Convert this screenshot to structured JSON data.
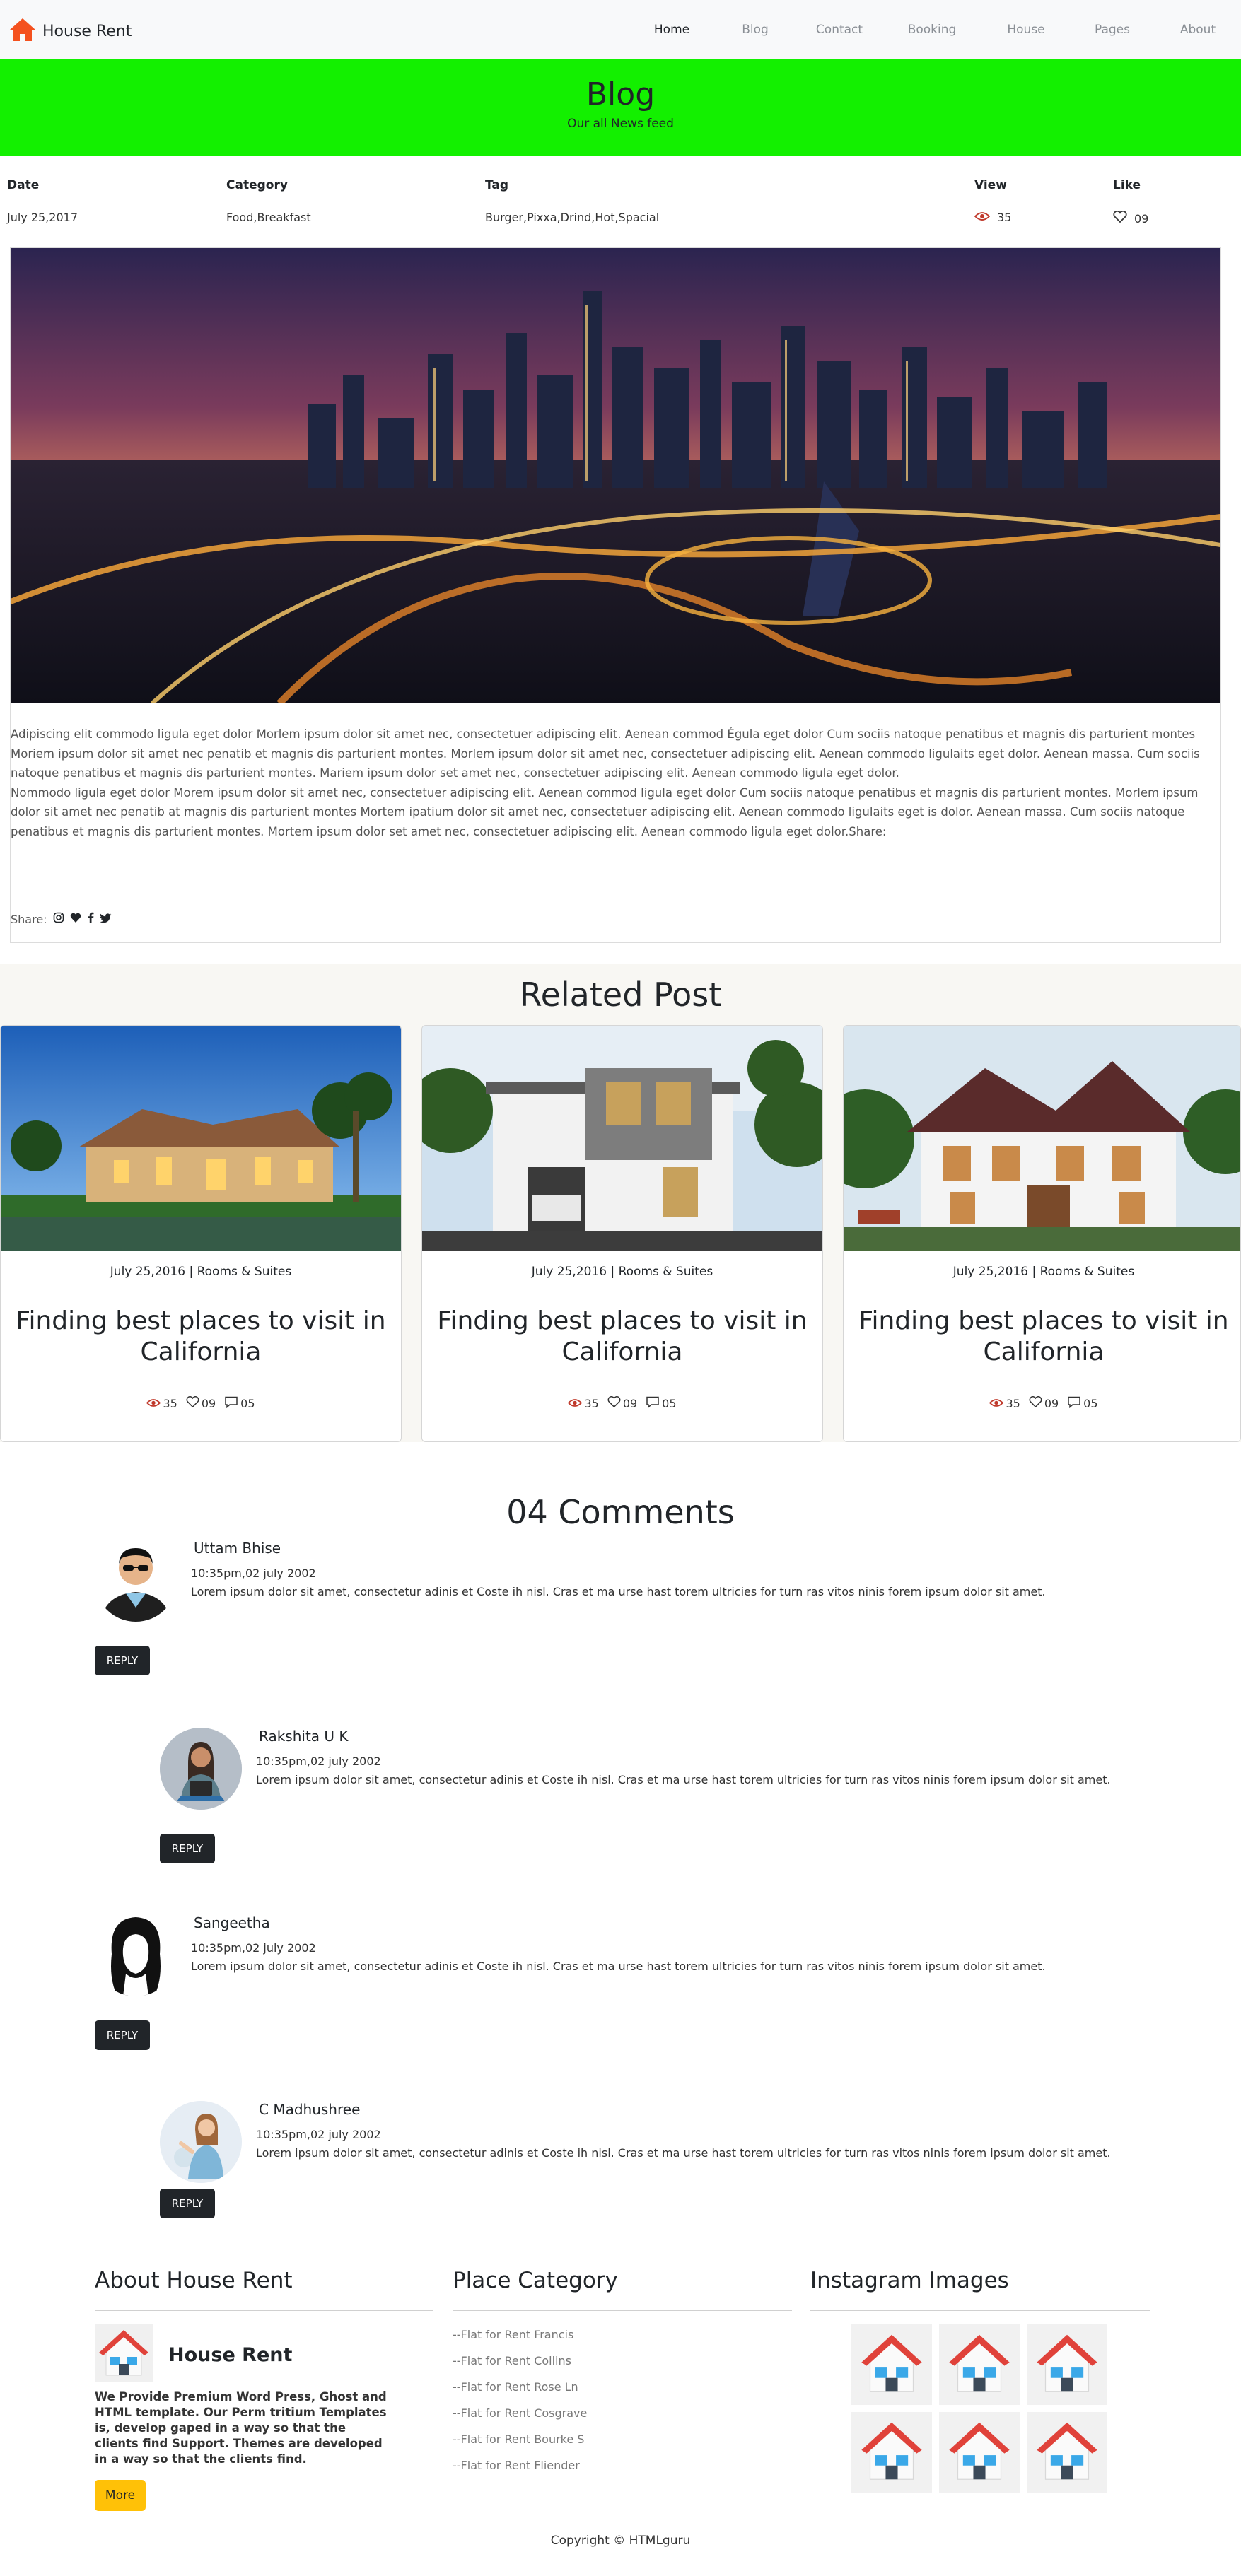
{
  "nav": {
    "brand": "House Rent",
    "links": [
      "Home",
      "Blog",
      "Contact",
      "Booking",
      "House",
      "Pages",
      "About"
    ],
    "active": "Home"
  },
  "banner": {
    "title": "Blog",
    "subtitle": "Our all News feed"
  },
  "meta": {
    "date_label": "Date",
    "date": "July 25,2017",
    "category_label": "Category",
    "category": "Food,Breakfast",
    "tag_label": "Tag",
    "tag": "Burger,Pixxa,Drind,Hot,Spacial",
    "view_label": "View",
    "views": "35",
    "like_label": "Like",
    "likes": "09"
  },
  "post": {
    "paragraph1": "Adipiscing elit commodo ligula eget dolor Morlem ipsum dolor sit amet nec, consectetuer adipiscing elit. Aenean commod Égula eget dolor Cum sociis natoque penatibus et magnis dis parturient montes Moriem ipsum dolor sit amet nec penatib et magnis dis parturient montes. Morlem ipsum dolor sit amet nec, consectetuer adipiscing elit. Aenean commodo ligulaits eget dolor. Aenean massa. Cum sociis natoque penatibus et magnis dis parturient montes. Mariem ipsum dolor set amet nec, consectetuer adipiscing elit. Aenean commodo ligula eget dolor.",
    "paragraph2": "Nommodo ligula eget dolor Morem ipsum dolor sit amet nec, consectetuer adipiscing elit. Aenean commod ligula eget dolor Cum sociis natoque penatibus et magnis dis parturient montes. Morlem ipsum dolor sit amet nec penatib at magnis dis parturient montes Mortem ipatium dolor sit amet nec, consectetuer adipiscing elit. Aenean commodo ligulaits eget is dolor. Aenean massa. Cum sociis natoque penatibus et magnis dis parturient montes. Mortem ipsum dolor set amet nec, consectetuer adipiscing elit. Aenean commodo ligula eget dolor.Share:",
    "share_label": "Share:"
  },
  "related": {
    "title": "Related Post",
    "cards": [
      {
        "date": "July 25,2016 | Rooms & Suites",
        "title": "Finding best places to visit in California",
        "views": "35",
        "likes": "09",
        "comments": "05"
      },
      {
        "date": "July 25,2016 | Rooms & Suites",
        "title": "Finding best places to visit in California",
        "views": "35",
        "likes": "09",
        "comments": "05"
      },
      {
        "date": "July 25,2016 | Rooms & Suites",
        "title": "Finding best places to visit in California",
        "views": "35",
        "likes": "09",
        "comments": "05"
      }
    ]
  },
  "comments": {
    "title": "04 Comments",
    "items": [
      {
        "name": "Uttam Bhise",
        "time": "10:35pm,02 july 2002",
        "text": "Lorem ipsum dolor sit amet, consectetur adinis et Coste ih nisl. Cras et ma urse hast torem ultricies for turn ras vitos ninis forem ipsum dolor sit amet.",
        "reply": "REPLY"
      },
      {
        "name": "Rakshita U K",
        "time": "10:35pm,02 july 2002",
        "text": "Lorem ipsum dolor sit amet, consectetur adinis et Coste ih nisl. Cras et ma urse hast torem ultricies for turn ras vitos ninis forem ipsum dolor sit amet.",
        "reply": "REPLY"
      },
      {
        "name": "Sangeetha",
        "time": "10:35pm,02 july 2002",
        "text": "Lorem ipsum dolor sit amet, consectetur adinis et Coste ih nisl. Cras et ma urse hast torem ultricies for turn ras vitos ninis forem ipsum dolor sit amet.",
        "reply": "REPLY"
      },
      {
        "name": "C Madhushree",
        "time": "10:35pm,02 july 2002",
        "text": "Lorem ipsum dolor sit amet, consectetur adinis et Coste ih nisl. Cras et ma urse hast torem ultricies for turn ras vitos ninis forem ipsum dolor sit amet.",
        "reply": "REPLY"
      }
    ]
  },
  "footer": {
    "about_title": "About House Rent",
    "about_brand": "House Rent",
    "about_text": "We Provide Premium Word Press, Ghost and HTML template. Our Perm tritium Templates is, develop gaped in a way so that the clients find Support. Themes are developed in a way so that the clients find.",
    "more_label": "More",
    "place_title": "Place Category",
    "places": [
      "--Flat for Rent Francis",
      "--Flat for Rent Collins",
      "--Flat for Rent Rose Ln",
      "--Flat for Rent Cosgrave",
      "--Flat for Rent Bourke S",
      "--Flat for Rent Fliender"
    ],
    "insta_title": "Instagram Images",
    "copyright": "Copyright © HTMLguru"
  },
  "colors": {
    "banner": "#13f000",
    "brand_icon": "#f4511e",
    "reply_button": "#212529",
    "more_button": "#ffc107"
  },
  "icons": [
    "home-icon",
    "eye-icon",
    "heart-icon",
    "comment-icon",
    "instagram-icon",
    "facebook-icon",
    "twitter-icon",
    "house-icon"
  ]
}
